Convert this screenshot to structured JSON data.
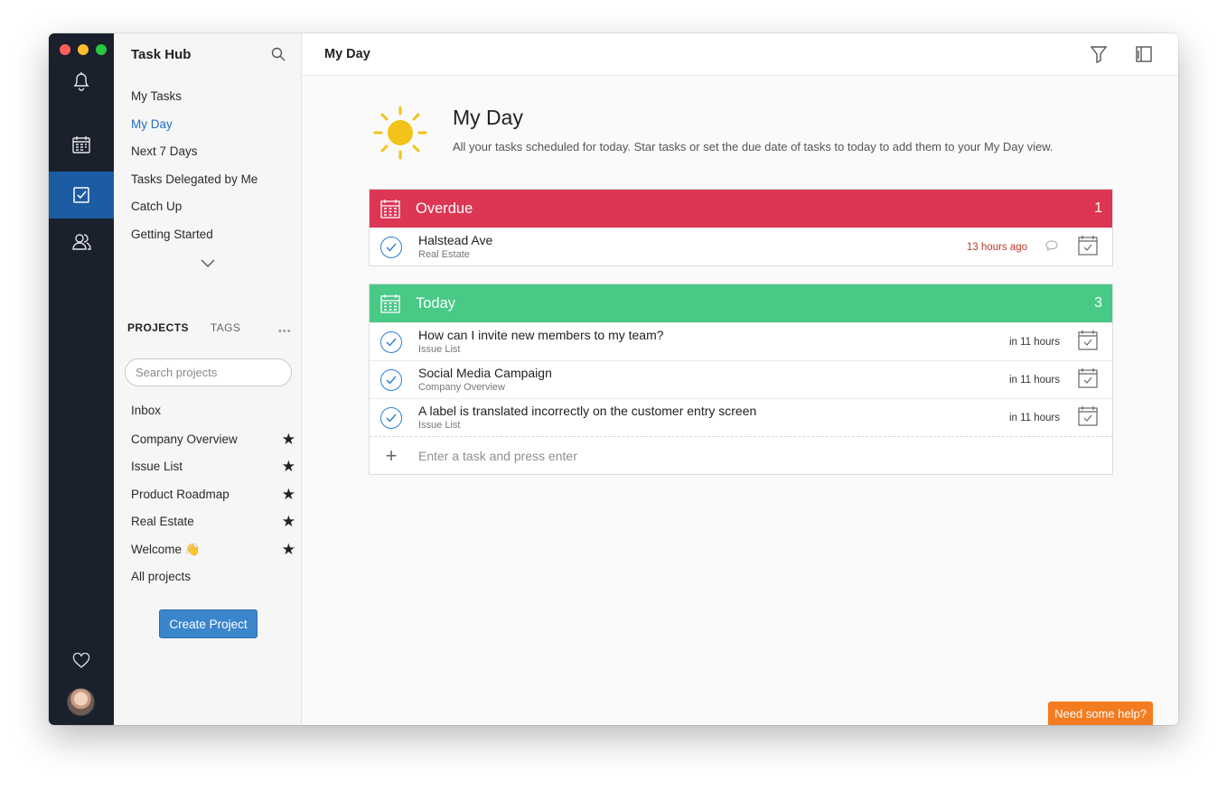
{
  "colors": {
    "rail_bg": "#1a202c",
    "rail_active": "#1c5ca3",
    "accent": "#1d6ec7",
    "overdue": "#dc3654",
    "today": "#48c986",
    "help": "#f47c20",
    "sun": "#f2c318"
  },
  "rail": {
    "items": [
      {
        "name": "notifications",
        "icon": "bell-icon"
      },
      {
        "name": "calendar",
        "icon": "calendar-icon"
      },
      {
        "name": "tasks",
        "icon": "checkbox-icon",
        "active": true
      },
      {
        "name": "people",
        "icon": "users-icon"
      }
    ],
    "bottom": [
      {
        "name": "favorites",
        "icon": "heart-icon"
      },
      {
        "name": "profile",
        "icon": "avatar"
      }
    ]
  },
  "sidebar": {
    "title": "Task Hub",
    "nav": [
      {
        "label": "My Tasks"
      },
      {
        "label": "My Day",
        "active": true
      },
      {
        "label": "Next 7 Days"
      },
      {
        "label": "Tasks Delegated by Me"
      },
      {
        "label": "Catch Up"
      },
      {
        "label": "Getting Started"
      }
    ],
    "tabs": {
      "projects": "PROJECTS",
      "tags": "TAGS",
      "menu": "•••"
    },
    "search_placeholder": "Search projects",
    "projects": [
      {
        "label": "Inbox",
        "starred": false
      },
      {
        "label": "Company Overview",
        "starred": true
      },
      {
        "label": "Issue List",
        "starred": true
      },
      {
        "label": "Product Roadmap",
        "starred": true
      },
      {
        "label": "Real Estate",
        "starred": true
      },
      {
        "label": "Welcome 👋",
        "starred": true
      },
      {
        "label": "All projects",
        "starred": false
      }
    ],
    "star_glyph": "★",
    "create_button": "Create Project"
  },
  "topbar": {
    "title": "My Day"
  },
  "hero": {
    "title": "My Day",
    "description": "All your tasks scheduled for today. Star tasks or set the due date of tasks to today to add them to your My Day view."
  },
  "sections": {
    "overdue": {
      "title": "Overdue",
      "count": "1",
      "tasks": [
        {
          "title": "Halstead Ave",
          "project": "Real Estate",
          "due": "13 hours ago"
        }
      ]
    },
    "today": {
      "title": "Today",
      "count": "3",
      "tasks": [
        {
          "title": "How can I invite new members to my team?",
          "project": "Issue List",
          "due": "in 11 hours"
        },
        {
          "title": "Social Media Campaign",
          "project": "Company Overview",
          "due": "in 11 hours"
        },
        {
          "title": "A label is translated incorrectly on the customer entry screen",
          "project": "Issue List",
          "due": "in 11 hours"
        }
      ],
      "add_placeholder": "Enter a task and press enter",
      "add_glyph": "+"
    }
  },
  "help_button": "Need some help?"
}
